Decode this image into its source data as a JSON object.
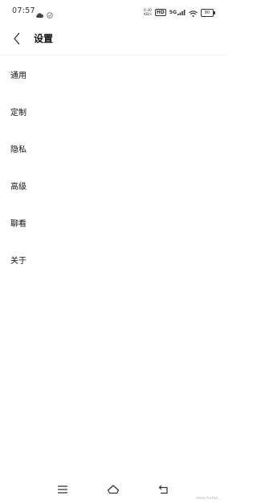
{
  "status_bar": {
    "time": "07:57",
    "net_speed_top": "0.30",
    "net_speed_bottom": "KB/s",
    "hd_label": "HD",
    "network_label": "5G",
    "battery_level": "80",
    "icons": [
      "cloud-icon",
      "check-circle-icon",
      "wifi-icon",
      "battery-icon"
    ]
  },
  "header": {
    "title": "设置",
    "back_icon": "chevron-left-icon"
  },
  "menu": {
    "items": [
      {
        "label": "通用"
      },
      {
        "label": "定制"
      },
      {
        "label": "隐私"
      },
      {
        "label": "高级"
      },
      {
        "label": "聊看"
      },
      {
        "label": "关于"
      }
    ]
  },
  "nav_bar": {
    "icons": [
      "menu-icon",
      "home-icon",
      "back-icon"
    ]
  },
  "watermark": {
    "text": "www.hutas..."
  }
}
